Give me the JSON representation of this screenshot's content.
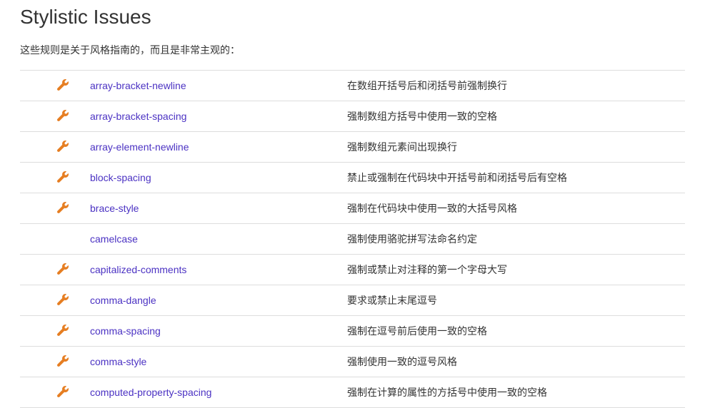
{
  "heading": "Stylistic Issues",
  "description": "这些规则是关于风格指南的，而且是非常主观的：",
  "rules": [
    {
      "fixable": true,
      "name": "array-bracket-newline",
      "desc": "在数组开括号后和闭括号前强制换行"
    },
    {
      "fixable": true,
      "name": "array-bracket-spacing",
      "desc": "强制数组方括号中使用一致的空格"
    },
    {
      "fixable": true,
      "name": "array-element-newline",
      "desc": "强制数组元素间出现换行"
    },
    {
      "fixable": true,
      "name": "block-spacing",
      "desc": "禁止或强制在代码块中开括号前和闭括号后有空格"
    },
    {
      "fixable": true,
      "name": "brace-style",
      "desc": "强制在代码块中使用一致的大括号风格"
    },
    {
      "fixable": false,
      "name": "camelcase",
      "desc": "强制使用骆驼拼写法命名约定"
    },
    {
      "fixable": true,
      "name": "capitalized-comments",
      "desc": "强制或禁止对注释的第一个字母大写"
    },
    {
      "fixable": true,
      "name": "comma-dangle",
      "desc": "要求或禁止末尾逗号"
    },
    {
      "fixable": true,
      "name": "comma-spacing",
      "desc": "强制在逗号前后使用一致的空格"
    },
    {
      "fixable": true,
      "name": "comma-style",
      "desc": "强制使用一致的逗号风格"
    },
    {
      "fixable": true,
      "name": "computed-property-spacing",
      "desc": "强制在计算的属性的方括号中使用一致的空格"
    }
  ]
}
